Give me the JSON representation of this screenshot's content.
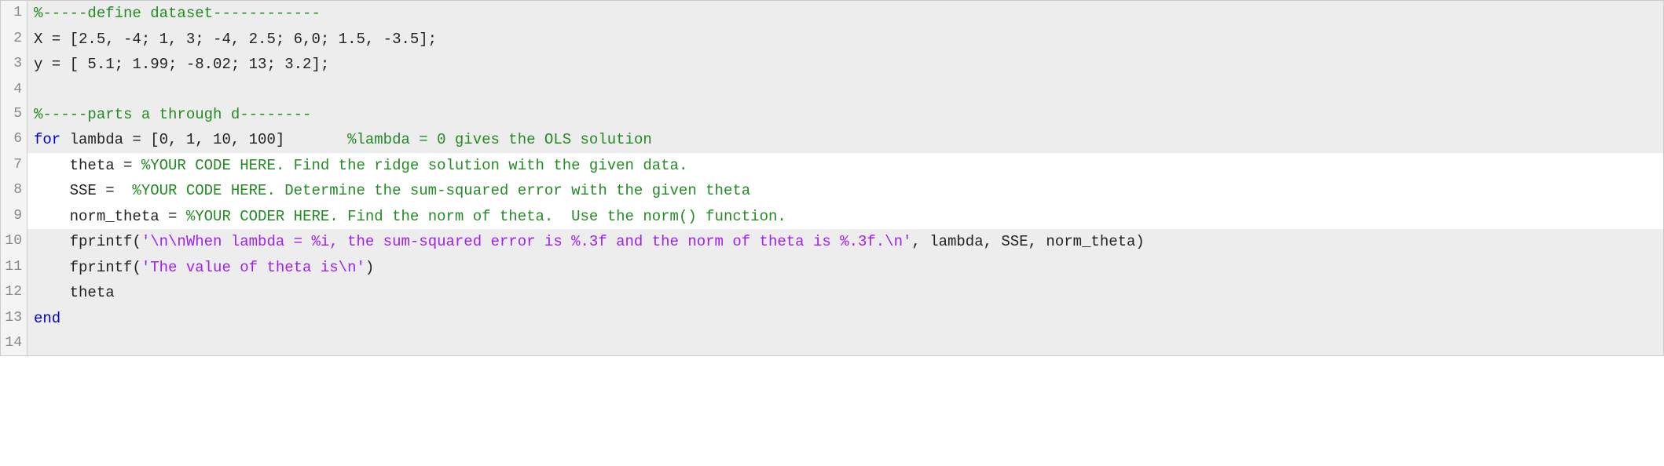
{
  "lines": [
    {
      "n": 1,
      "shaded": true,
      "segs": [
        {
          "cls": "c",
          "t": "%-----define dataset------------"
        }
      ]
    },
    {
      "n": 2,
      "shaded": true,
      "segs": [
        {
          "cls": "t",
          "t": "X = [2.5, -4; 1, 3; -4, 2.5; 6,0; 1.5, -3.5];"
        }
      ]
    },
    {
      "n": 3,
      "shaded": true,
      "segs": [
        {
          "cls": "t",
          "t": "y = [ 5.1; 1.99; -8.02; 13; 3.2];"
        }
      ]
    },
    {
      "n": 4,
      "shaded": true,
      "segs": [
        {
          "cls": "t",
          "t": ""
        }
      ]
    },
    {
      "n": 5,
      "shaded": true,
      "segs": [
        {
          "cls": "c",
          "t": "%-----parts a through d--------"
        }
      ]
    },
    {
      "n": 6,
      "shaded": true,
      "segs": [
        {
          "cls": "k",
          "t": "for "
        },
        {
          "cls": "t",
          "t": "lambda = [0, 1, 10, 100]       "
        },
        {
          "cls": "c",
          "t": "%lambda = 0 gives the OLS solution"
        }
      ]
    },
    {
      "n": 7,
      "shaded": false,
      "segs": [
        {
          "cls": "t",
          "t": "    theta = "
        },
        {
          "cls": "c",
          "t": "%YOUR CODE HERE. Find the ridge solution with the given data."
        }
      ]
    },
    {
      "n": 8,
      "shaded": false,
      "segs": [
        {
          "cls": "t",
          "t": "    SSE =  "
        },
        {
          "cls": "c",
          "t": "%YOUR CODE HERE. Determine the sum-squared error with the given theta"
        }
      ]
    },
    {
      "n": 9,
      "shaded": false,
      "segs": [
        {
          "cls": "t",
          "t": "    norm_theta = "
        },
        {
          "cls": "c",
          "t": "%YOUR CODER HERE. Find the norm of theta.  Use the norm() function."
        }
      ]
    },
    {
      "n": 10,
      "shaded": true,
      "segs": [
        {
          "cls": "t",
          "t": "    fprintf("
        },
        {
          "cls": "s",
          "t": "'\\n\\nWhen lambda = %i, the sum-squared error is %.3f and the norm of theta is %.3f.\\n'"
        },
        {
          "cls": "t",
          "t": ", lambda, SSE, norm_theta)"
        }
      ]
    },
    {
      "n": 11,
      "shaded": true,
      "segs": [
        {
          "cls": "t",
          "t": "    fprintf("
        },
        {
          "cls": "s",
          "t": "'The value of theta is\\n'"
        },
        {
          "cls": "t",
          "t": ")"
        }
      ]
    },
    {
      "n": 12,
      "shaded": true,
      "segs": [
        {
          "cls": "t",
          "t": "    theta"
        }
      ]
    },
    {
      "n": 13,
      "shaded": true,
      "segs": [
        {
          "cls": "k",
          "t": "end"
        }
      ]
    },
    {
      "n": 14,
      "shaded": true,
      "segs": [
        {
          "cls": "t",
          "t": ""
        }
      ]
    }
  ]
}
